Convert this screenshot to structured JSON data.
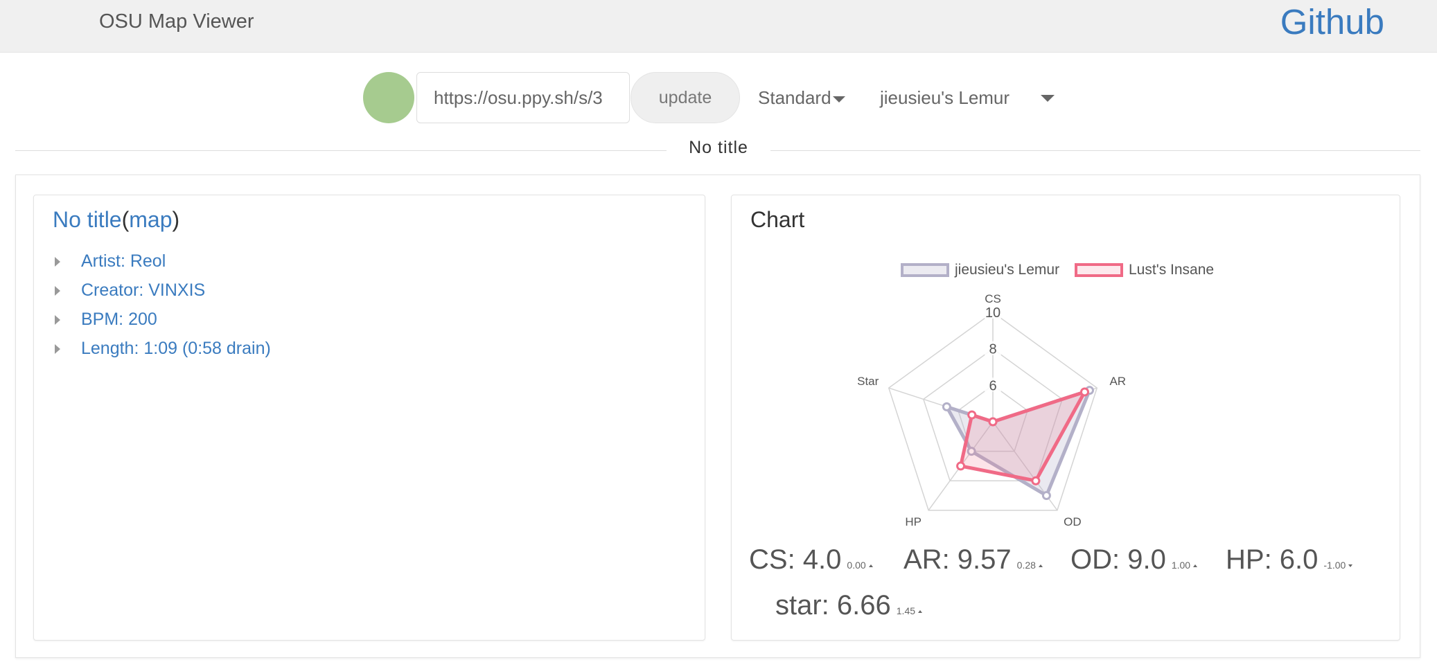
{
  "navbar": {
    "brand": "OSU Map Viewer",
    "github_label": "Github"
  },
  "toolbar": {
    "avatar_color": "#a6cb8f",
    "url_value": "https://osu.ppy.sh/s/3",
    "update_label": "update",
    "mode_selected": "Standard",
    "difficulty_selected": "jieusieu's Lemur"
  },
  "divider_title": "No title",
  "map_card": {
    "title": "No title",
    "open_paren": "(",
    "map_link": "map",
    "close_paren": ")",
    "items": [
      "Artist: Reol",
      "Creator: VINXIS",
      "BPM: 200",
      "Length: 1:09 (0:58 drain)"
    ]
  },
  "chart_card": {
    "title": "Chart",
    "stats": [
      {
        "label": "CS: 4.0",
        "delta": "0.00",
        "direction": "up"
      },
      {
        "label": "AR: 9.57",
        "delta": "0.28",
        "direction": "up"
      },
      {
        "label": "OD: 9.0",
        "delta": "1.00",
        "direction": "up"
      },
      {
        "label": "HP: 6.0",
        "delta": "-1.00",
        "direction": "down"
      },
      {
        "label": "star: 6.66",
        "delta": "1.45",
        "direction": "up"
      }
    ]
  },
  "chart_data": {
    "type": "radar",
    "axes": [
      "CS",
      "AR",
      "OD",
      "HP",
      "Star"
    ],
    "scale_ticks": [
      "6",
      "8",
      "10"
    ],
    "scale_range": [
      4,
      10
    ],
    "series": [
      {
        "name": "jieusieu's Lemur",
        "values": [
          4.0,
          9.57,
          9.0,
          6.0,
          6.66
        ],
        "color": "#b3b0c8"
      },
      {
        "name": "Lust's Insane",
        "values": [
          4.0,
          9.29,
          8.0,
          7.0,
          5.21
        ],
        "color": "#f06a86"
      }
    ]
  }
}
